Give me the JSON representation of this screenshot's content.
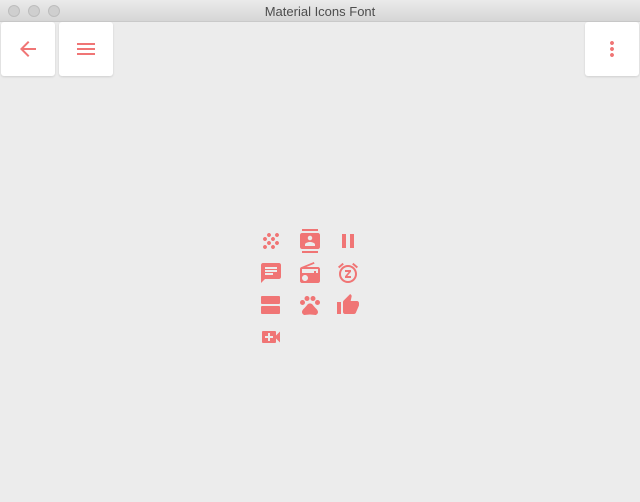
{
  "window": {
    "title": "Material Icons Font"
  },
  "toolbar": {
    "back_icon": "arrow-back-icon",
    "menu_icon": "menu-icon",
    "more_icon": "more-vert-icon"
  },
  "icons": [
    "grain-icon",
    "contact-mail-icon",
    "pause-icon",
    "chat-icon",
    "radio-icon",
    "snooze-icon",
    "view-agenda-icon",
    "pets-icon",
    "thumb-up-icon",
    "video-call-icon"
  ],
  "colors": {
    "accent": "#f07575",
    "background": "#ececec"
  }
}
